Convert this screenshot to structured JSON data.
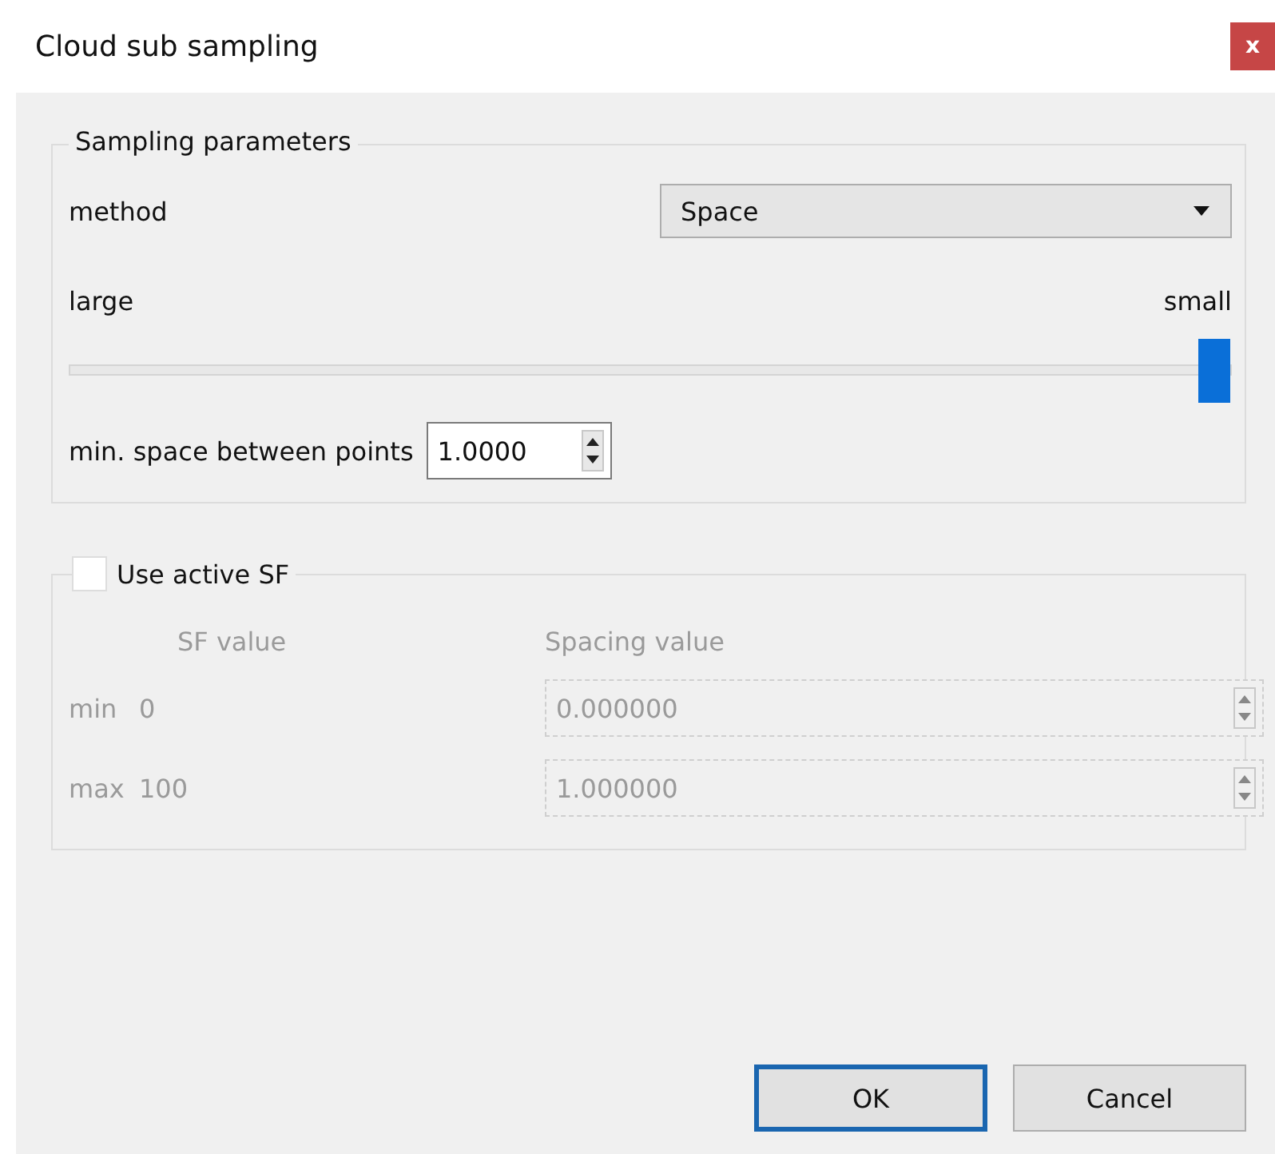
{
  "window": {
    "title": "Cloud sub sampling",
    "close": "x"
  },
  "sampling": {
    "title": "Sampling parameters",
    "method_label": "method",
    "method": "Space",
    "left_label": "large",
    "right_label": "small",
    "level": 1.0,
    "spacing_label": "min. space between points",
    "spacing": "1.0000"
  },
  "sf": {
    "label": "Use active SF",
    "checked": false,
    "disabled": true,
    "sf_header": "SF value",
    "spacing_header": "Spacing value",
    "rows": [
      {
        "label": "min",
        "sf": "0",
        "spacing": "0.000000"
      },
      {
        "label": "max",
        "sf": "100",
        "spacing": "1.000000"
      }
    ]
  },
  "buttons": [
    {
      "label": "OK",
      "default": true
    },
    {
      "label": "Cancel",
      "default": false
    }
  ]
}
